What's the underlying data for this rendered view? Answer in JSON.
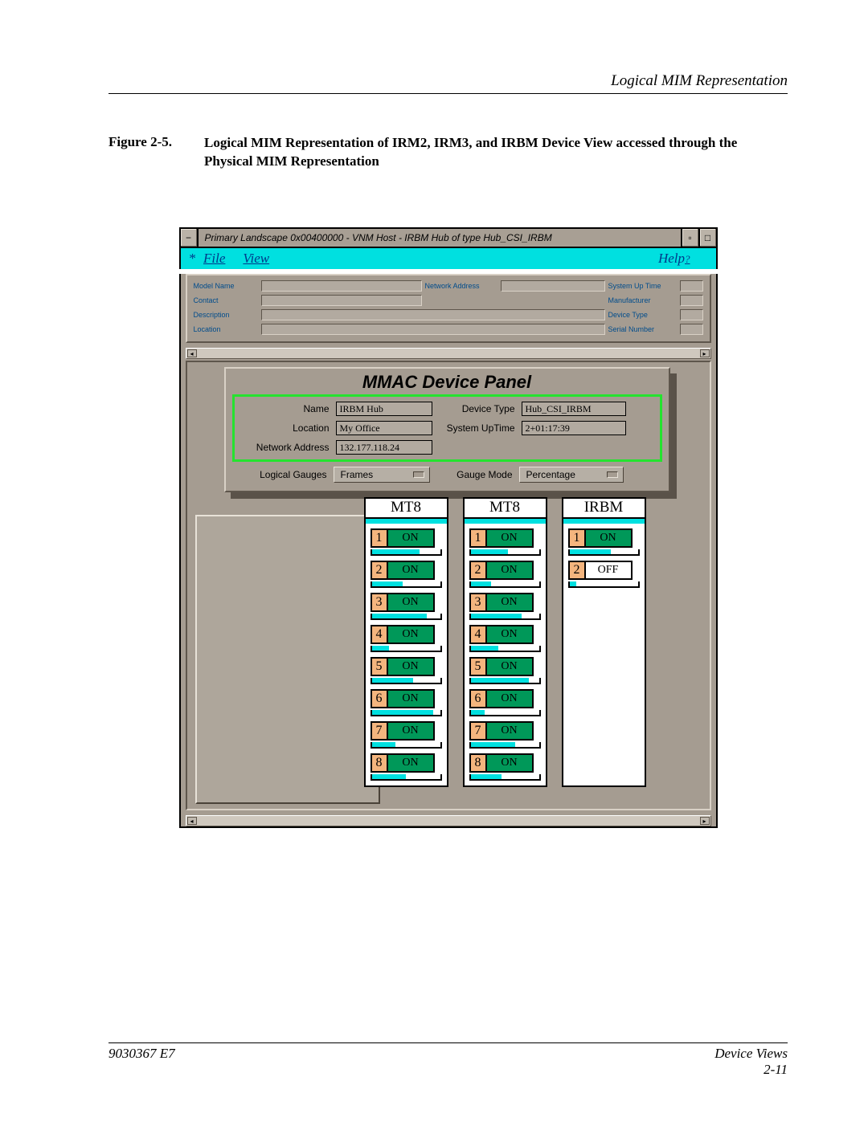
{
  "doc": {
    "header": "Logical MIM Representation",
    "figure_label": "Figure 2-5.",
    "figure_text": "Logical MIM Representation of IRM2, IRM3, and IRBM Device View accessed through the Physical MIM Representation",
    "footer_left": "9030367 E7",
    "footer_right_a": "Device Views",
    "footer_right_b": "2-11"
  },
  "window": {
    "title": "Primary Landscape 0x00400000 - VNM Host - IRBM Hub of type Hub_CSI_IRBM",
    "menu": {
      "file": "File",
      "view": "View",
      "help": "Help",
      "star": "*",
      "q": "?"
    },
    "info_labels": {
      "model_name": "Model Name",
      "network_address": "Network Address",
      "system_up_time": "System Up Time",
      "contact": "Contact",
      "manufacturer": "Manufacturer",
      "description": "Description",
      "device_type": "Device Type",
      "location": "Location",
      "serial_number": "Serial Number"
    }
  },
  "mmac": {
    "title": "MMAC Device Panel",
    "labels": {
      "name": "Name",
      "location": "Location",
      "network_address": "Network Address",
      "device_type": "Device Type",
      "system_uptime": "System UpTime",
      "logical_gauges": "Logical Gauges",
      "gauge_mode": "Gauge Mode"
    },
    "values": {
      "name": "IRBM Hub",
      "location": "My Office",
      "network_address": "132.177.118.24",
      "device_type": "Hub_CSI_IRBM",
      "system_uptime": "2+01:17:39",
      "logical_gauges": "Frames",
      "gauge_mode": "Percentage"
    }
  },
  "modules": [
    {
      "name": "MT8",
      "ports": [
        {
          "n": "1",
          "s": "ON",
          "on": true,
          "g": 70
        },
        {
          "n": "2",
          "s": "ON",
          "on": true,
          "g": 45
        },
        {
          "n": "3",
          "s": "ON",
          "on": true,
          "g": 80
        },
        {
          "n": "4",
          "s": "ON",
          "on": true,
          "g": 25
        },
        {
          "n": "5",
          "s": "ON",
          "on": true,
          "g": 60
        },
        {
          "n": "6",
          "s": "ON",
          "on": true,
          "g": 90
        },
        {
          "n": "7",
          "s": "ON",
          "on": true,
          "g": 35
        },
        {
          "n": "8",
          "s": "ON",
          "on": true,
          "g": 50
        }
      ]
    },
    {
      "name": "MT8",
      "ports": [
        {
          "n": "1",
          "s": "ON",
          "on": true,
          "g": 55
        },
        {
          "n": "2",
          "s": "ON",
          "on": true,
          "g": 30
        },
        {
          "n": "3",
          "s": "ON",
          "on": true,
          "g": 75
        },
        {
          "n": "4",
          "s": "ON",
          "on": true,
          "g": 40
        },
        {
          "n": "5",
          "s": "ON",
          "on": true,
          "g": 85
        },
        {
          "n": "6",
          "s": "ON",
          "on": true,
          "g": 20
        },
        {
          "n": "7",
          "s": "ON",
          "on": true,
          "g": 65
        },
        {
          "n": "8",
          "s": "ON",
          "on": true,
          "g": 45
        }
      ]
    },
    {
      "name": "IRBM",
      "ports": [
        {
          "n": "1",
          "s": "ON",
          "on": true,
          "g": 60
        },
        {
          "n": "2",
          "s": "OFF",
          "on": false,
          "g": 10
        }
      ]
    }
  ]
}
